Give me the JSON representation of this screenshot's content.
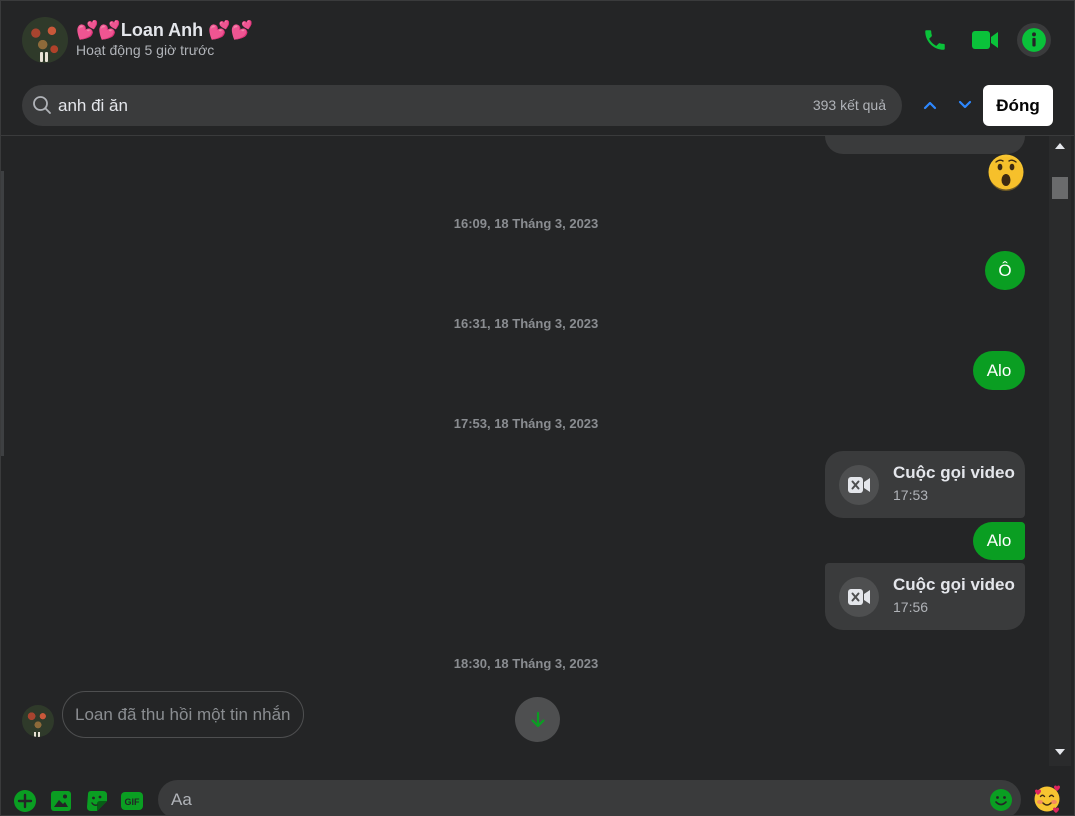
{
  "header": {
    "name": "💕💕Loan Anh 💕💕",
    "status": "Hoạt động 5 giờ trước",
    "icons": {
      "call": "phone-icon",
      "video": "video-camera-icon",
      "info": "info-icon"
    }
  },
  "search": {
    "query": "anh đi ăn",
    "result_count": "393 kết quả",
    "close_label": "Đóng",
    "icons": {
      "search": "search-icon",
      "prev": "chevron-up-icon",
      "next": "chevron-down-icon"
    }
  },
  "messages": {
    "top_reaction": "😮",
    "timestamps": [
      "16:09, 18 Tháng 3, 2023",
      "16:31, 18 Tháng 3, 2023",
      "17:53, 18 Tháng 3, 2023",
      "18:30, 18 Tháng 3, 2023"
    ],
    "bubbles": [
      "Ô",
      "Alo",
      "Alo"
    ],
    "calls": [
      {
        "title": "Cuộc gọi video",
        "time": "17:53"
      },
      {
        "title": "Cuộc gọi video",
        "time": "17:56"
      }
    ],
    "recalled_text": "Loan đã thu hồi một tin nhắn"
  },
  "composer": {
    "placeholder": "Aa",
    "buttons": [
      "plus-icon",
      "image-icon",
      "sticker-icon",
      "gif-icon"
    ],
    "gif_label": "GIF",
    "reaction_emoji": "🥰"
  },
  "colors": {
    "accent": "#0a9e22",
    "icon_green": "#0ac23a",
    "background": "#242526",
    "surface": "#3a3b3c"
  }
}
